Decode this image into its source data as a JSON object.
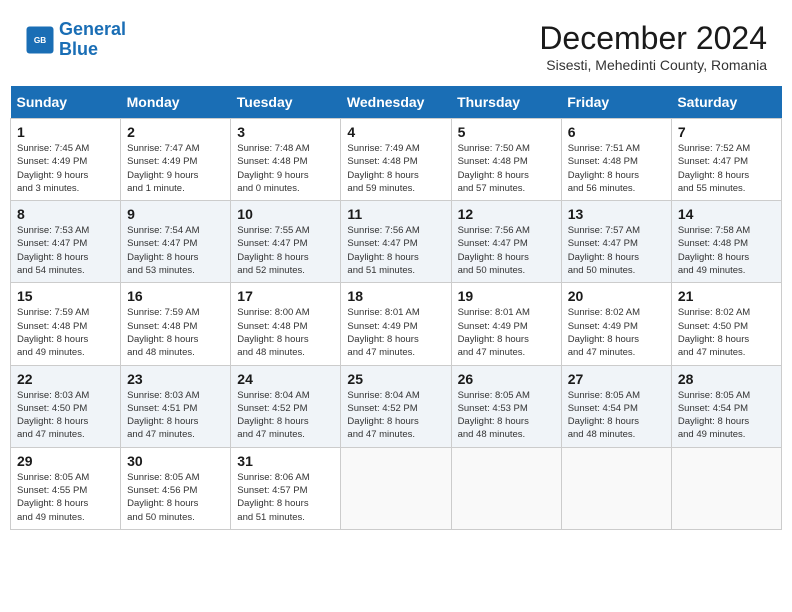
{
  "logo": {
    "line1": "General",
    "line2": "Blue"
  },
  "header": {
    "month": "December 2024",
    "location": "Sisesti, Mehedinti County, Romania"
  },
  "weekdays": [
    "Sunday",
    "Monday",
    "Tuesday",
    "Wednesday",
    "Thursday",
    "Friday",
    "Saturday"
  ],
  "weeks": [
    [
      {
        "day": "1",
        "info": "Sunrise: 7:45 AM\nSunset: 4:49 PM\nDaylight: 9 hours\nand 3 minutes."
      },
      {
        "day": "2",
        "info": "Sunrise: 7:47 AM\nSunset: 4:49 PM\nDaylight: 9 hours\nand 1 minute."
      },
      {
        "day": "3",
        "info": "Sunrise: 7:48 AM\nSunset: 4:48 PM\nDaylight: 9 hours\nand 0 minutes."
      },
      {
        "day": "4",
        "info": "Sunrise: 7:49 AM\nSunset: 4:48 PM\nDaylight: 8 hours\nand 59 minutes."
      },
      {
        "day": "5",
        "info": "Sunrise: 7:50 AM\nSunset: 4:48 PM\nDaylight: 8 hours\nand 57 minutes."
      },
      {
        "day": "6",
        "info": "Sunrise: 7:51 AM\nSunset: 4:48 PM\nDaylight: 8 hours\nand 56 minutes."
      },
      {
        "day": "7",
        "info": "Sunrise: 7:52 AM\nSunset: 4:47 PM\nDaylight: 8 hours\nand 55 minutes."
      }
    ],
    [
      {
        "day": "8",
        "info": "Sunrise: 7:53 AM\nSunset: 4:47 PM\nDaylight: 8 hours\nand 54 minutes."
      },
      {
        "day": "9",
        "info": "Sunrise: 7:54 AM\nSunset: 4:47 PM\nDaylight: 8 hours\nand 53 minutes."
      },
      {
        "day": "10",
        "info": "Sunrise: 7:55 AM\nSunset: 4:47 PM\nDaylight: 8 hours\nand 52 minutes."
      },
      {
        "day": "11",
        "info": "Sunrise: 7:56 AM\nSunset: 4:47 PM\nDaylight: 8 hours\nand 51 minutes."
      },
      {
        "day": "12",
        "info": "Sunrise: 7:56 AM\nSunset: 4:47 PM\nDaylight: 8 hours\nand 50 minutes."
      },
      {
        "day": "13",
        "info": "Sunrise: 7:57 AM\nSunset: 4:47 PM\nDaylight: 8 hours\nand 50 minutes."
      },
      {
        "day": "14",
        "info": "Sunrise: 7:58 AM\nSunset: 4:48 PM\nDaylight: 8 hours\nand 49 minutes."
      }
    ],
    [
      {
        "day": "15",
        "info": "Sunrise: 7:59 AM\nSunset: 4:48 PM\nDaylight: 8 hours\nand 49 minutes."
      },
      {
        "day": "16",
        "info": "Sunrise: 7:59 AM\nSunset: 4:48 PM\nDaylight: 8 hours\nand 48 minutes."
      },
      {
        "day": "17",
        "info": "Sunrise: 8:00 AM\nSunset: 4:48 PM\nDaylight: 8 hours\nand 48 minutes."
      },
      {
        "day": "18",
        "info": "Sunrise: 8:01 AM\nSunset: 4:49 PM\nDaylight: 8 hours\nand 47 minutes."
      },
      {
        "day": "19",
        "info": "Sunrise: 8:01 AM\nSunset: 4:49 PM\nDaylight: 8 hours\nand 47 minutes."
      },
      {
        "day": "20",
        "info": "Sunrise: 8:02 AM\nSunset: 4:49 PM\nDaylight: 8 hours\nand 47 minutes."
      },
      {
        "day": "21",
        "info": "Sunrise: 8:02 AM\nSunset: 4:50 PM\nDaylight: 8 hours\nand 47 minutes."
      }
    ],
    [
      {
        "day": "22",
        "info": "Sunrise: 8:03 AM\nSunset: 4:50 PM\nDaylight: 8 hours\nand 47 minutes."
      },
      {
        "day": "23",
        "info": "Sunrise: 8:03 AM\nSunset: 4:51 PM\nDaylight: 8 hours\nand 47 minutes."
      },
      {
        "day": "24",
        "info": "Sunrise: 8:04 AM\nSunset: 4:52 PM\nDaylight: 8 hours\nand 47 minutes."
      },
      {
        "day": "25",
        "info": "Sunrise: 8:04 AM\nSunset: 4:52 PM\nDaylight: 8 hours\nand 47 minutes."
      },
      {
        "day": "26",
        "info": "Sunrise: 8:05 AM\nSunset: 4:53 PM\nDaylight: 8 hours\nand 48 minutes."
      },
      {
        "day": "27",
        "info": "Sunrise: 8:05 AM\nSunset: 4:54 PM\nDaylight: 8 hours\nand 48 minutes."
      },
      {
        "day": "28",
        "info": "Sunrise: 8:05 AM\nSunset: 4:54 PM\nDaylight: 8 hours\nand 49 minutes."
      }
    ],
    [
      {
        "day": "29",
        "info": "Sunrise: 8:05 AM\nSunset: 4:55 PM\nDaylight: 8 hours\nand 49 minutes."
      },
      {
        "day": "30",
        "info": "Sunrise: 8:05 AM\nSunset: 4:56 PM\nDaylight: 8 hours\nand 50 minutes."
      },
      {
        "day": "31",
        "info": "Sunrise: 8:06 AM\nSunset: 4:57 PM\nDaylight: 8 hours\nand 51 minutes."
      },
      {
        "day": "",
        "info": ""
      },
      {
        "day": "",
        "info": ""
      },
      {
        "day": "",
        "info": ""
      },
      {
        "day": "",
        "info": ""
      }
    ]
  ]
}
